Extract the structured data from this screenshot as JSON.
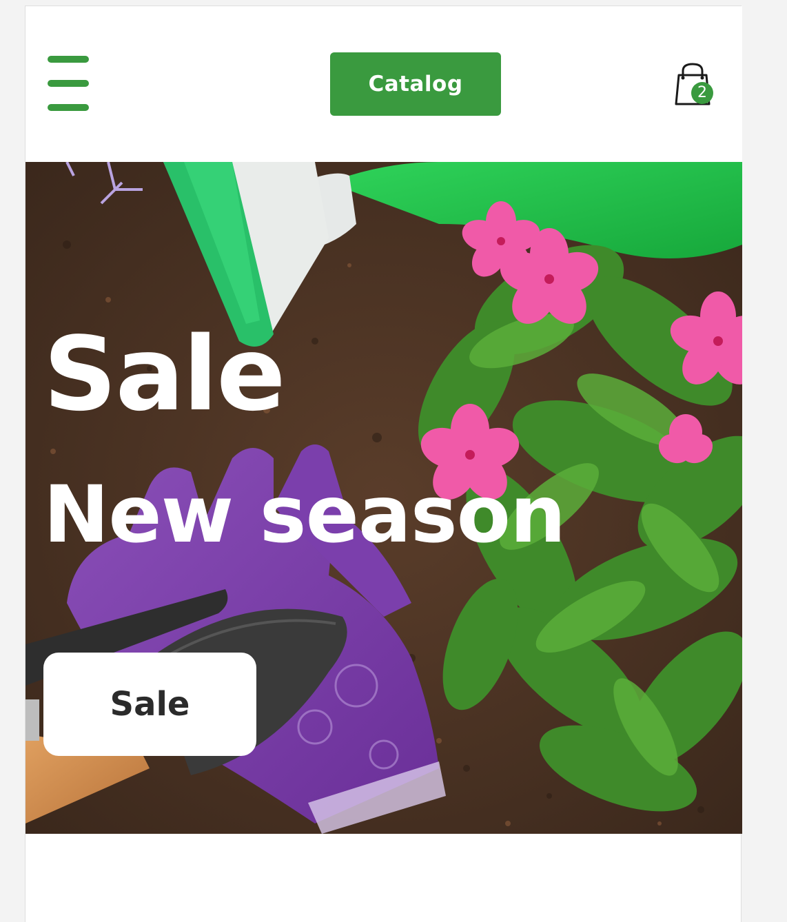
{
  "header": {
    "menu_icon": "hamburger-menu-icon",
    "catalog_label": "Catalog",
    "cart_icon": "shopping-bag-icon",
    "cart_count": "2"
  },
  "hero": {
    "title": "Sale",
    "subtitle": "New season",
    "button_label": "Sale",
    "image_alt": "gardening tools, purple gloves, watering can and pink flowers on soil"
  },
  "colors": {
    "accent": "#3a9a3f",
    "white": "#ffffff",
    "button_text": "#2b2b2b",
    "soil": "#4a3325"
  }
}
